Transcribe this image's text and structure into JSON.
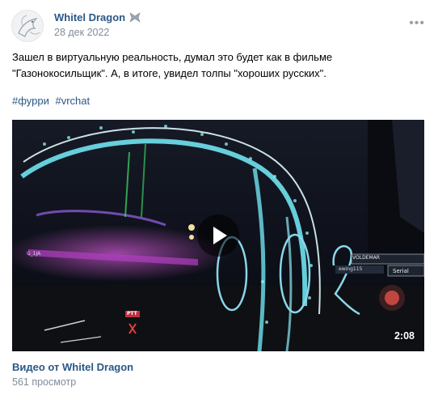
{
  "post": {
    "author": "Whitel Dragon",
    "date": "28 дек 2022",
    "menu_icon": "more-dots-icon",
    "text_lines": [
      "Зашел в виртуальную реальность, думал это будет как в фильме",
      "\"Газонокосильщик\". А, в итоге, увидел толпы \"хороших русских\"."
    ],
    "hashtags": [
      "#фурри",
      "#vrchat"
    ],
    "video": {
      "duration": "2:08",
      "title": "Видео от Whitel Dragon",
      "views": "561 просмотр",
      "overlay_labels": {
        "nameplate_1": "VOLDEMAR",
        "nameplate_2": "Serial",
        "nameplate_3": "ewing115",
        "nameplate_4": "G_1JA",
        "mic_label": "PTT"
      }
    }
  },
  "colors": {
    "link": "#2a5885",
    "secondary_text": "#818c99",
    "neon_cyan": "#6fe3f0"
  }
}
